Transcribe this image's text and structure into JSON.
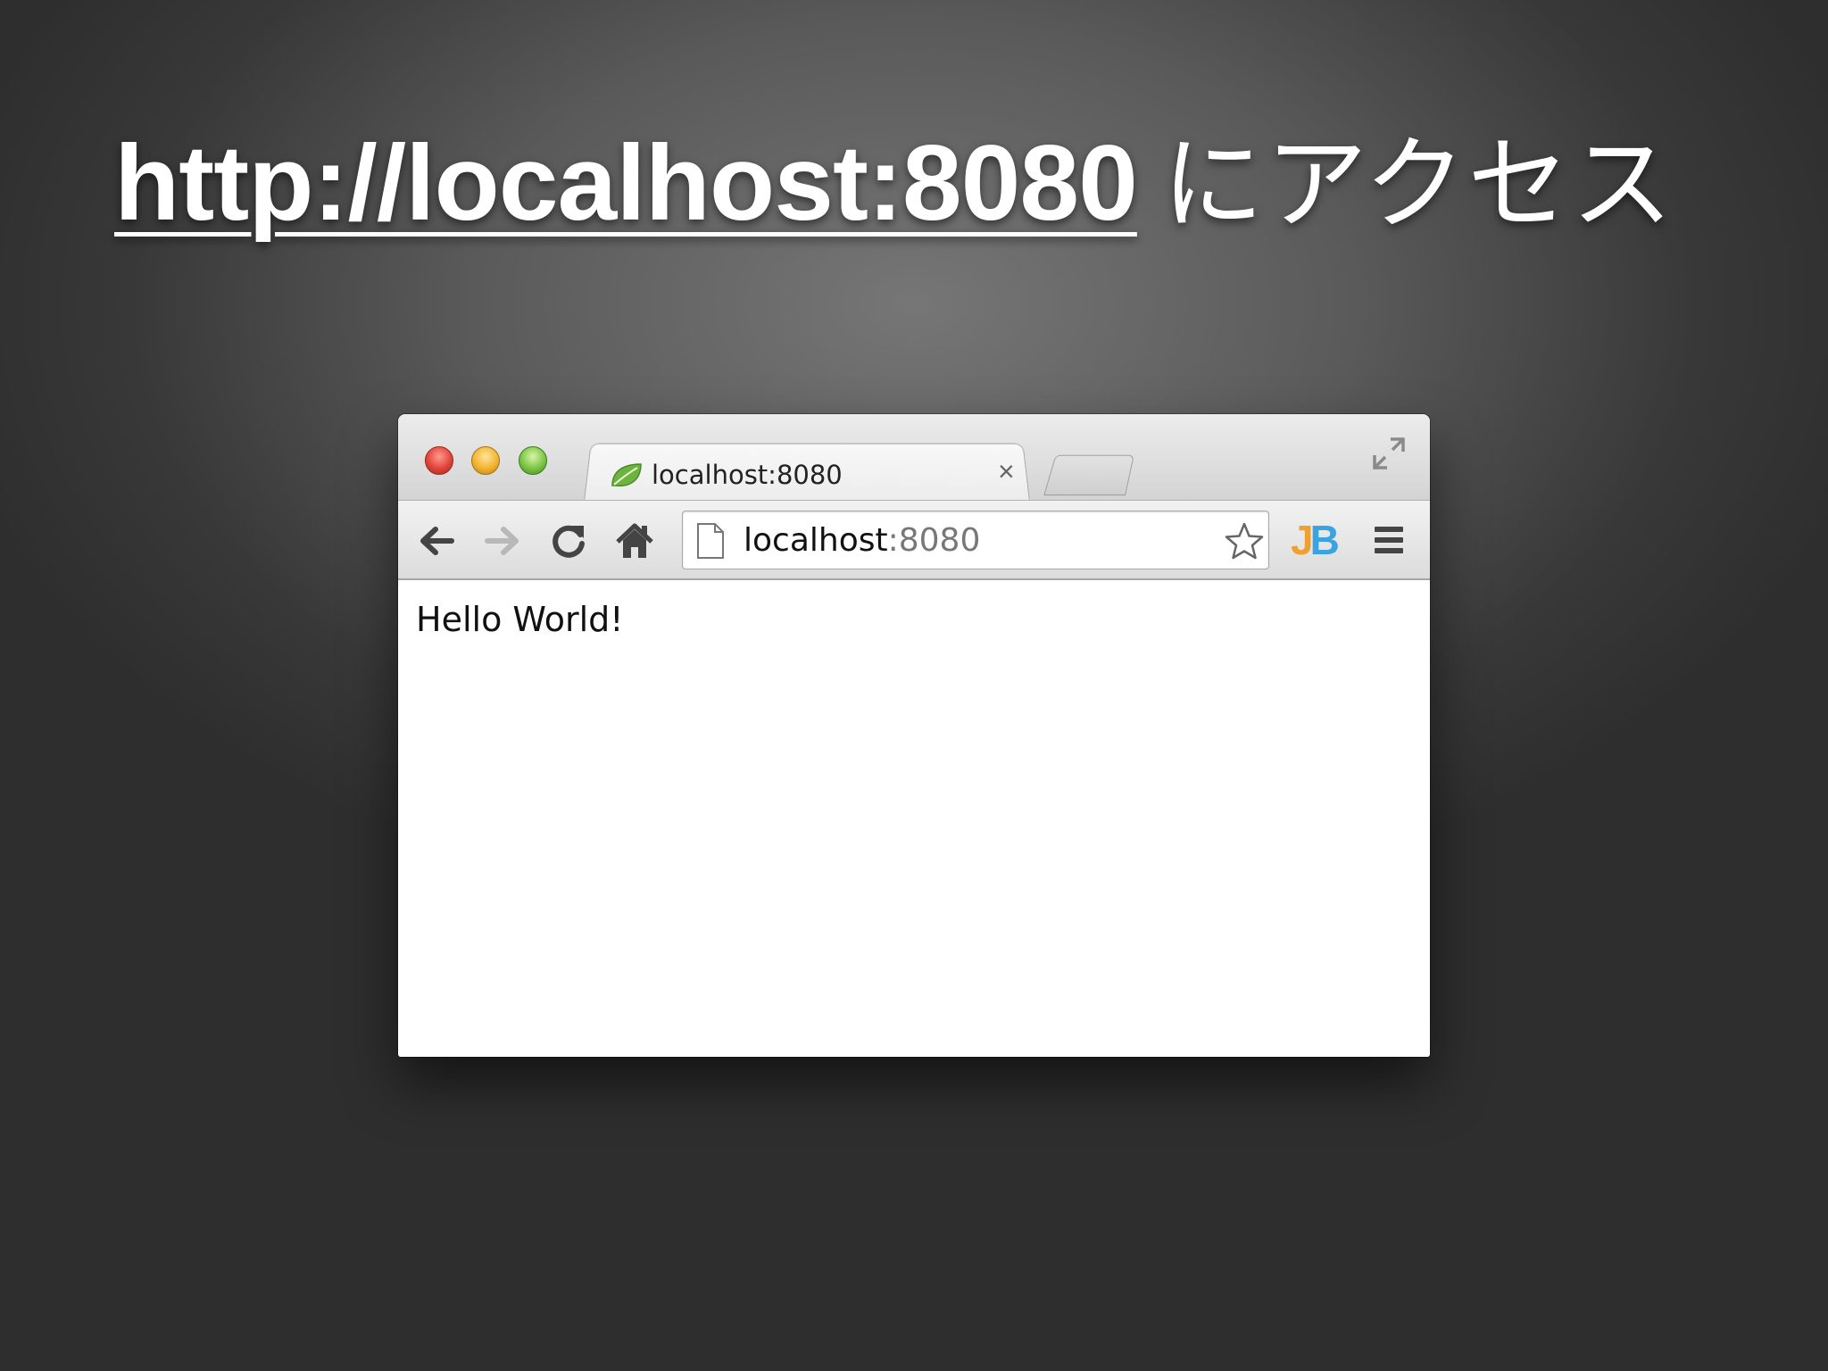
{
  "slide": {
    "title_url": "http://localhost:8080",
    "title_suffix": "にアクセス"
  },
  "browser": {
    "tab": {
      "label": "localhost:8080",
      "close_glyph": "×"
    },
    "omnibox": {
      "host": "localhost",
      "port": ":8080"
    },
    "extension": {
      "j": "J",
      "b": "B"
    },
    "page": {
      "body_text": "Hello World!"
    }
  },
  "icons": {
    "window_controls": [
      "close-icon",
      "minimize-icon",
      "zoom-icon"
    ],
    "favicon": "spring-leaf-icon",
    "toolbar": [
      "back-arrow-icon",
      "forward-arrow-icon",
      "reload-icon",
      "home-icon"
    ],
    "omnibox": [
      "page-icon",
      "star-icon"
    ],
    "menu": "hamburger-menu-icon",
    "fullscreen": "fullscreen-icon"
  },
  "colors": {
    "extension_j": "#f0a030",
    "extension_b": "#3aa3e0",
    "leaf": "#6db33f"
  }
}
